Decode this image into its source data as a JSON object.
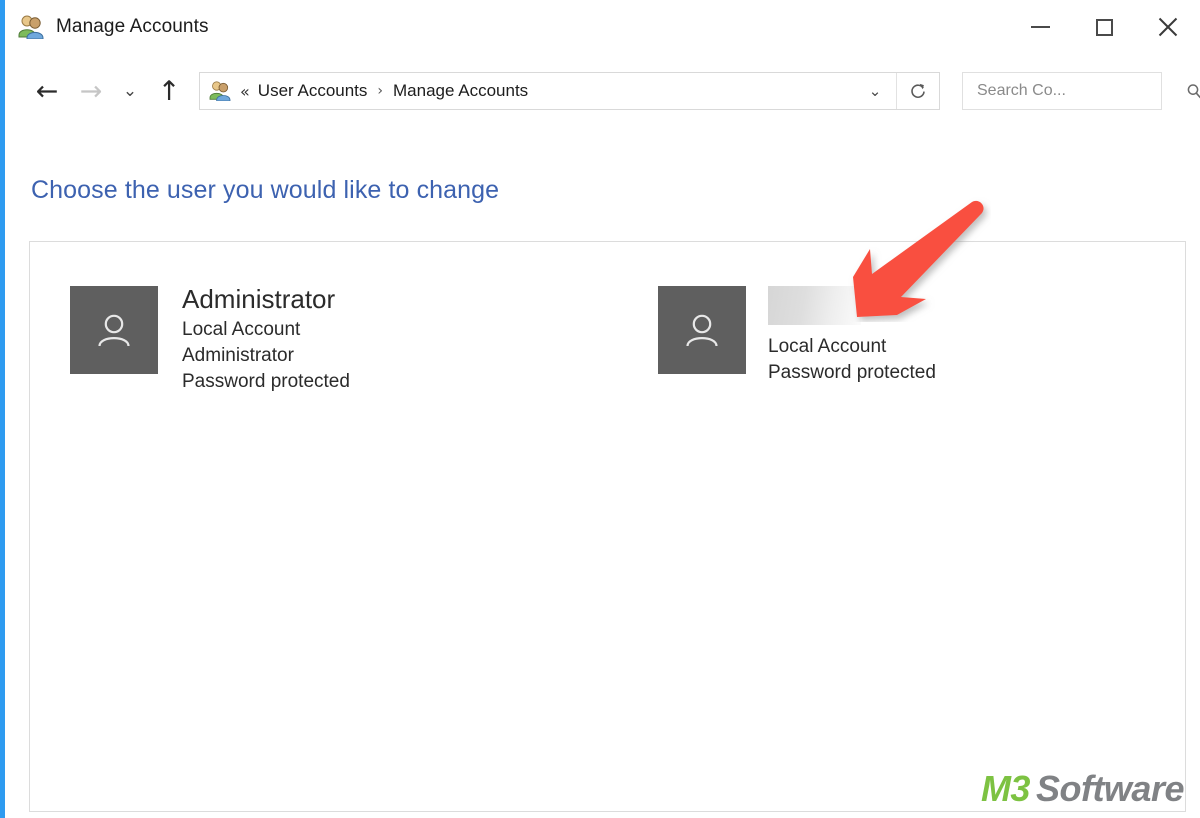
{
  "window": {
    "title": "Manage Accounts",
    "title_icon": "user-accounts-icon",
    "accent_border_color": "#2E9BF0",
    "controls": {
      "minimize_label": "Minimize",
      "maximize_label": "Maximize",
      "close_label": "Close"
    }
  },
  "navbar": {
    "back_label": "←",
    "forward_label": "→",
    "recent_label": "⌄",
    "up_label": "↑",
    "breadcrumb": {
      "icon": "user-accounts-icon",
      "overflow": "«",
      "separator": "›",
      "items": [
        {
          "label": "User Accounts"
        },
        {
          "label": "Manage Accounts"
        }
      ]
    },
    "dropdown_label": "⌄",
    "refresh_label": "Refresh",
    "search": {
      "placeholder": "Search Co...",
      "value": "",
      "icon": "search-icon"
    }
  },
  "content": {
    "heading": "Choose the user you would like to change",
    "heading_color": "#3D62B0",
    "accounts": [
      {
        "name": "Administrator",
        "redacted": false,
        "lines": [
          "Local Account",
          "Administrator",
          "Password protected"
        ]
      },
      {
        "name": "",
        "redacted": true,
        "lines": [
          "Local Account",
          "Password protected"
        ]
      }
    ]
  },
  "annotation": {
    "arrow_color": "#F9503F",
    "arrow_name": "red-pointer-arrow"
  },
  "watermark": {
    "brand": "M3",
    "brand_color": "#7DC242",
    "suffix": "Software",
    "suffix_color": "#808285"
  }
}
